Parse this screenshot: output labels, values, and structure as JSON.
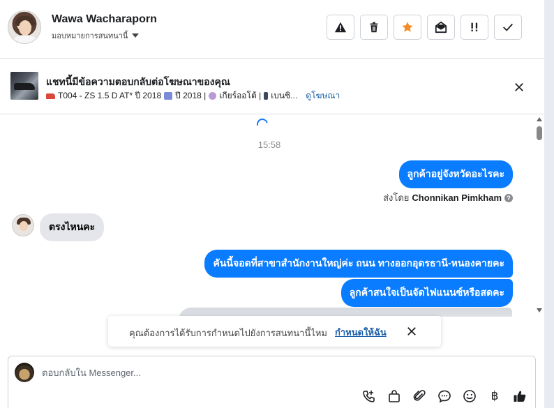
{
  "header": {
    "user_name": "Wawa Wacharaporn",
    "assign_label": "มอบหมายการสนทนานี้",
    "actions": [
      "spam-warning",
      "delete",
      "star",
      "mark-unread",
      "follow-up",
      "done"
    ]
  },
  "ad": {
    "title": "แชทนี้มีข้อความตอบกลับต่อโฆษณาของคุณ",
    "meta": {
      "model": "T004 - ZS 1.5 D AT* ปี 2018",
      "year": "ปี 2018 |",
      "transmission": "เกียร์ออโต้ |",
      "fuel": "เบนซิ...",
      "view_ad_link": "ดูโฆษณา"
    }
  },
  "conversation": {
    "timestamp": "15:58",
    "messages": [
      {
        "direction": "out",
        "text": "ลูกค้าอยู่จังหวัดอะไรคะ"
      },
      {
        "direction": "in",
        "text": "ตรงไหนคะ"
      },
      {
        "direction": "out",
        "text": "คันนี้จอดที่สาขาสำนักงานใหญ่ค่ะ ถนน ทางออกอุดรธานี-หนองคายคะ"
      },
      {
        "direction": "out",
        "text": "ลูกค้าสนใจเป็นจัดไฟแนนซ์หรือสดคะ"
      }
    ],
    "sent_by_prefix": "ส่งโดย",
    "sent_by_agent": "Chonnikan Pimkham"
  },
  "prompt": {
    "text": "คุณต้องการได้รับการกำหนดไปยังการสนทนานี้ไหม",
    "link": "กำหนดให้ฉัน"
  },
  "composer": {
    "placeholder": "ตอบกลับใน Messenger...",
    "tools": [
      "phone-add-icon",
      "shopping-bag-icon",
      "paperclip-icon",
      "saved-reply-icon",
      "emoji-icon",
      "baht-icon",
      "thumbs-up-icon"
    ],
    "baht_symbol": "฿"
  },
  "colors": {
    "outgoing_bubble": "#0a7cff",
    "incoming_bubble": "#e4e6eb",
    "star_accent": "#f28c28",
    "link": "#1a5fa8"
  }
}
